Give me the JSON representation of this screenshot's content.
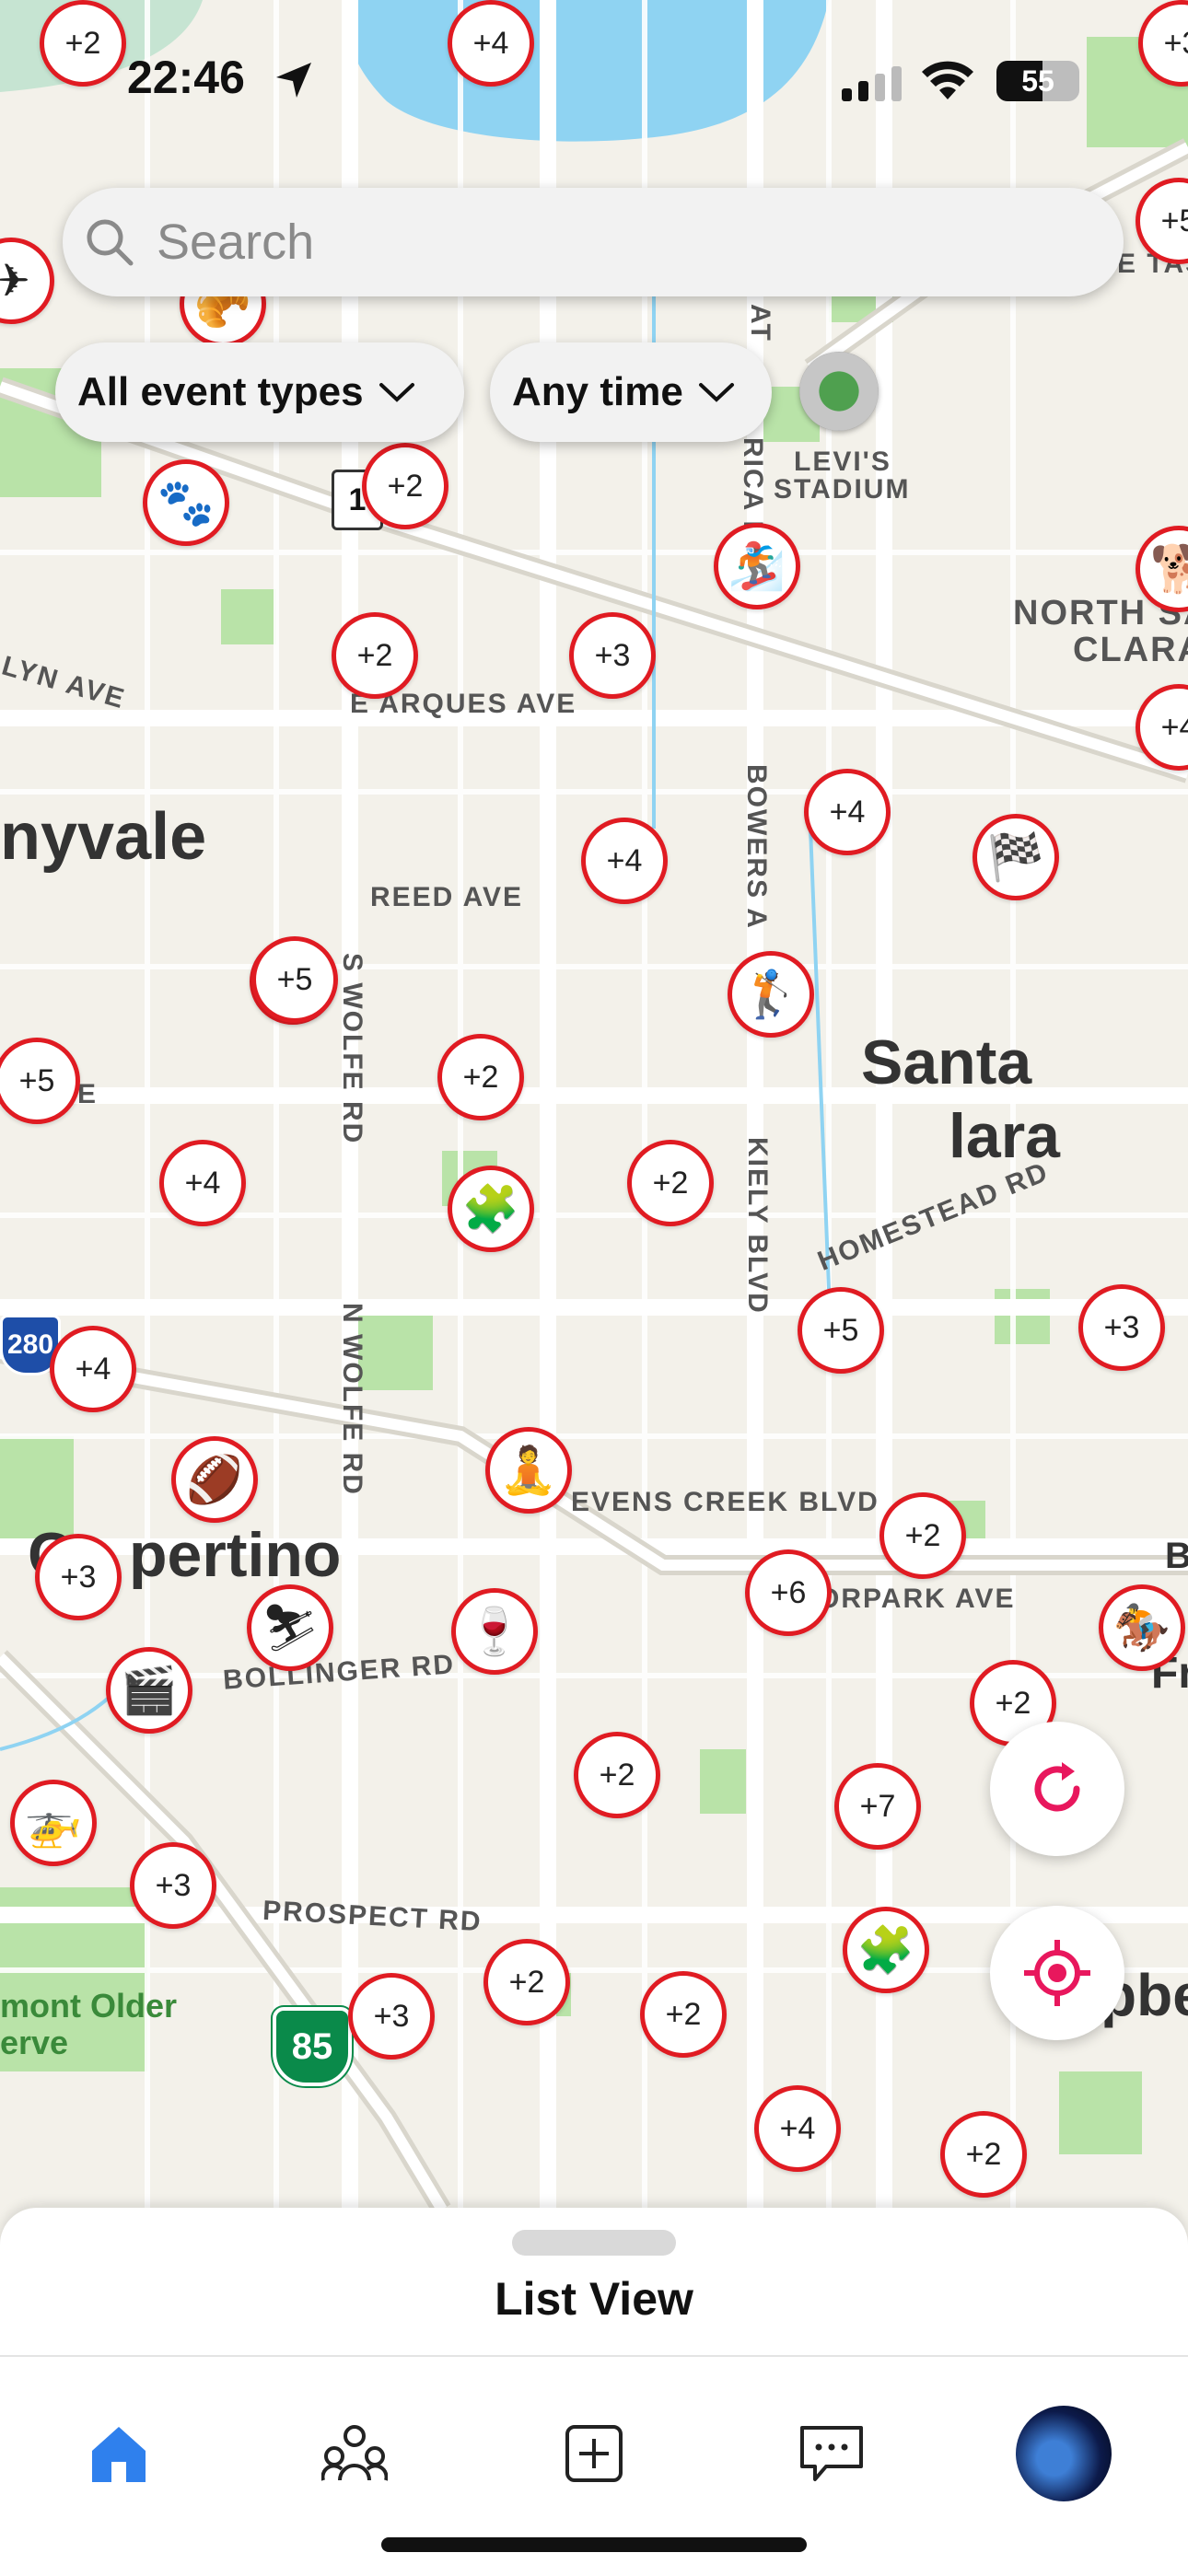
{
  "status_bar": {
    "time": "22:46",
    "battery": "55"
  },
  "search": {
    "placeholder": "Search"
  },
  "filters": {
    "event_types": "All event types",
    "time": "Any time"
  },
  "map_labels": {
    "levis": "LEVI'S",
    "stadium": "STADIUM",
    "north_santa": "NORTH SA",
    "clara": "CLARA",
    "lyn_ave": "LYN AVE",
    "arques": "E ARQUES AVE",
    "sunnyvale": "nyvale",
    "reed": "REED AVE",
    "bowers": "BOWERS A",
    "santa": "Santa",
    "clara_city": "lara",
    "s_wolfe": "S WOLFE RD",
    "kiely": "KIELY BLVD",
    "homestead": "HOMESTEAD RD",
    "n_wolfe": "N WOLFE RD",
    "stevens": "EVENS CREEK BLVD",
    "cupertino_pre": "C",
    "cupertino": "pertino",
    "bollinger": "BOLLINGER RD",
    "moorpark": "ORPARK AVE",
    "prospect": "PROSPECT RD",
    "mont_older": "mont Older",
    "erve": "erve",
    "hwy85": "85",
    "hwy280": "280",
    "hwy1": "1",
    "e_tas": "E TAS",
    "ave_left": "VE",
    "campbell": "pbe",
    "fru": "Fru",
    "b_edge": "B",
    "rica": "RICA P",
    "at": "AT"
  },
  "markers": [
    {
      "label": "+2"
    },
    {
      "label": "+4"
    },
    {
      "label": "+3"
    },
    {
      "label": "+2"
    },
    {
      "label": "+2"
    },
    {
      "label": "+3"
    },
    {
      "label": "+4"
    },
    {
      "label": "+4"
    },
    {
      "label": "+4"
    },
    {
      "label": "+5"
    },
    {
      "label": "+2"
    },
    {
      "label": "+5"
    },
    {
      "label": "+2"
    },
    {
      "label": "+4"
    },
    {
      "label": "+2"
    },
    {
      "label": "+5"
    },
    {
      "label": "+3"
    },
    {
      "label": "+4"
    },
    {
      "label": "+3"
    },
    {
      "label": "+2"
    },
    {
      "label": "+6"
    },
    {
      "label": "+2"
    },
    {
      "label": "+2"
    },
    {
      "label": "+7"
    },
    {
      "label": "+3"
    },
    {
      "label": "+2"
    },
    {
      "label": "+3"
    },
    {
      "label": "+2"
    },
    {
      "label": "+4"
    },
    {
      "label": "+2"
    },
    {
      "label": "+5"
    },
    {
      "emoji": "🐾"
    },
    {
      "emoji": "🏂"
    },
    {
      "emoji": "🏁"
    },
    {
      "emoji": "🏌"
    },
    {
      "emoji": "🧩"
    },
    {
      "emoji": "🏈"
    },
    {
      "emoji": "🧘"
    },
    {
      "emoji": "⛷"
    },
    {
      "emoji": "🍷"
    },
    {
      "emoji": "🎬"
    },
    {
      "emoji": "🚁"
    },
    {
      "emoji": "🧩"
    },
    {
      "emoji": "🏇"
    },
    {
      "emoji": "✈"
    },
    {
      "emoji": "🥐"
    },
    {
      "emoji": "🐕"
    }
  ],
  "fab": {
    "refresh": "refresh-icon",
    "locate": "locate-icon"
  },
  "sheet": {
    "title": "List View"
  },
  "tabs": [
    "home",
    "groups",
    "create",
    "messages",
    "profile"
  ],
  "colors": {
    "marker": "#e01b22",
    "home_tab": "#2f80ed",
    "fab_icon": "#e8175d"
  }
}
